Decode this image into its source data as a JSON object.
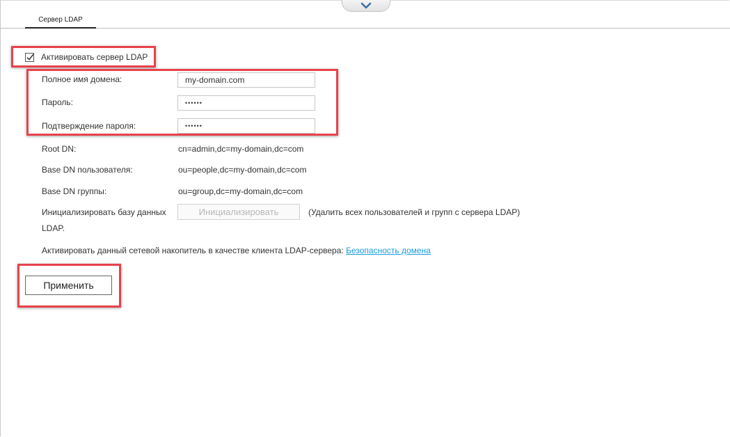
{
  "tabs": [
    {
      "label": "Сервер LDAP",
      "active": true
    }
  ],
  "enable_ldap": {
    "label": "Активировать сервер LDAP",
    "checked": true
  },
  "fields": {
    "domain": {
      "label": "Полное имя домена:",
      "value": "my-domain.com"
    },
    "password": {
      "label": "Пароль:",
      "value": "••••••"
    },
    "confirm_password": {
      "label": "Подтверждение пароля:",
      "value": "••••••"
    }
  },
  "info": {
    "root_dn": {
      "label": "Root DN:",
      "value": "cn=admin,dc=my-domain,dc=com"
    },
    "user_base_dn": {
      "label": "Base DN пользователя:",
      "value": "ou=people,dc=my-domain,dc=com"
    },
    "group_base_dn": {
      "label": "Base DN группы:",
      "value": "ou=group,dc=my-domain,dc=com"
    }
  },
  "init_db": {
    "label_line1": "Инициализировать базу данных",
    "label_line2": "LDAP.",
    "button_label": "Инициализировать",
    "note": "(Удалить всех пользователей и групп с сервера LDAP)"
  },
  "client": {
    "text": "Активировать данный сетевой накопитель в качестве клиента LDAP-сервера: ",
    "link": "Безопасность домена"
  },
  "apply_label": "Применить",
  "colors": {
    "highlight": "#e8424b",
    "link": "#1a9bdc"
  },
  "icons": {
    "collapse": "chevron-down-icon",
    "checkbox": "checkmark-icon"
  }
}
